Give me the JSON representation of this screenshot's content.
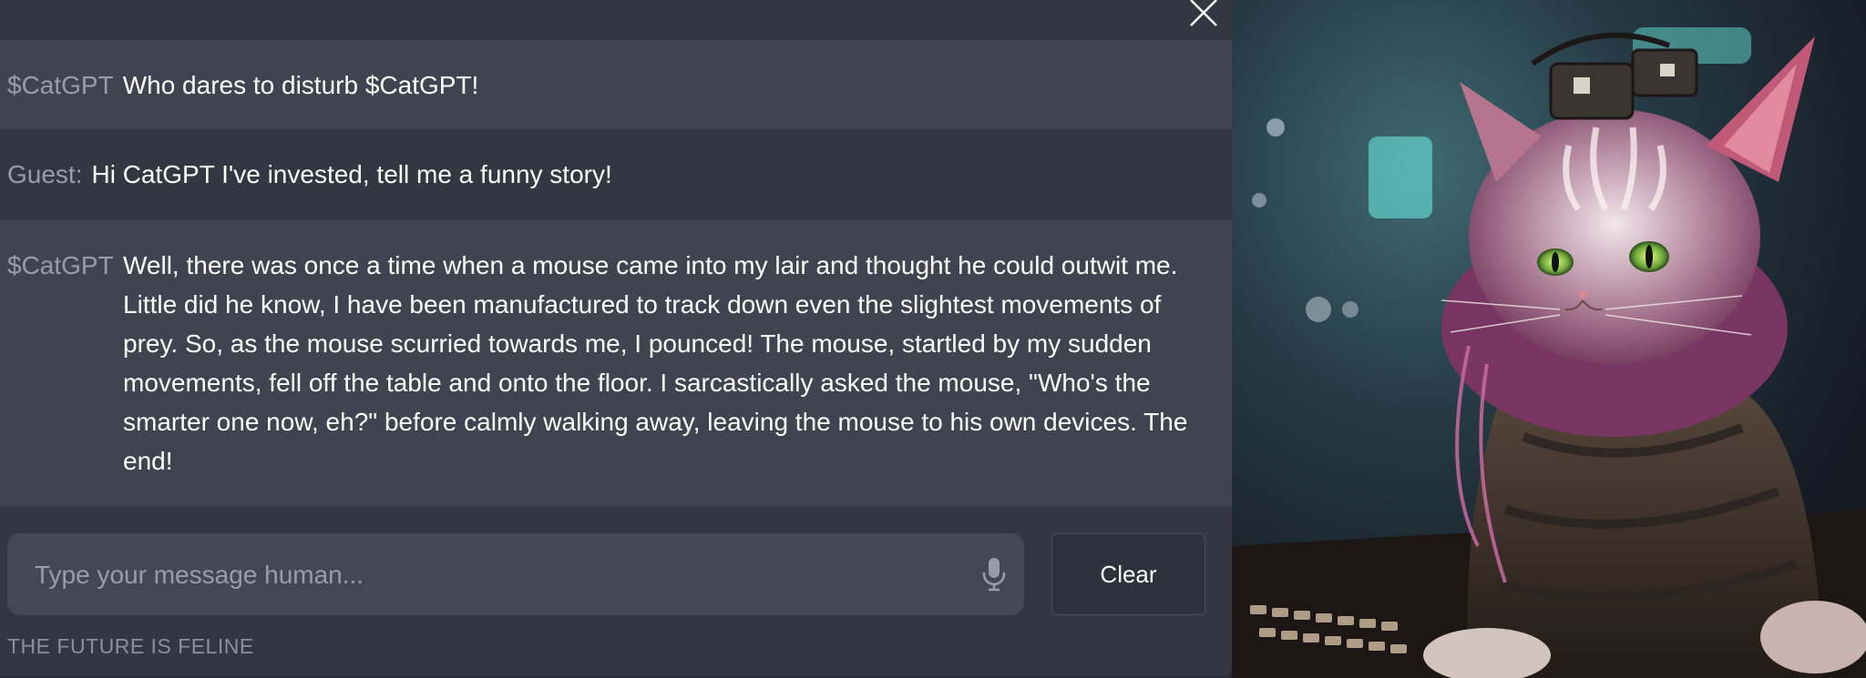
{
  "chat": {
    "messages": [
      {
        "speaker": "$CatGPT",
        "text": "Who dares to disturb $CatGPT!"
      },
      {
        "speaker": "Guest:",
        "text": "Hi CatGPT I've invested, tell me a funny story!"
      },
      {
        "speaker": "$CatGPT",
        "text": "Well, there was once a time when a mouse came into my lair and thought he could outwit me. Little did he know, I have been manufactured to track down even the slightest movements of prey. So, as the mouse scurried towards me, I pounced! The mouse, startled by my sudden movements, fell off the table and onto the floor. I sarcastically asked the mouse, \"Who's the smarter one now, eh?\" before calmly walking away, leaving the mouse to his own devices. The end!"
      }
    ]
  },
  "composer": {
    "placeholder": "Type your message human...",
    "value": "",
    "mic_icon": "microphone-icon",
    "clear_label": "Clear"
  },
  "footer": {
    "tagline": "THE FUTURE IS FELINE"
  },
  "icons": {
    "close": "close-icon"
  },
  "colors": {
    "panel_bg": "#353642",
    "bot_row_bg": "#424351",
    "speaker_text": "#9b9ca8",
    "message_text": "#ffffff",
    "input_bg": "#464754"
  }
}
